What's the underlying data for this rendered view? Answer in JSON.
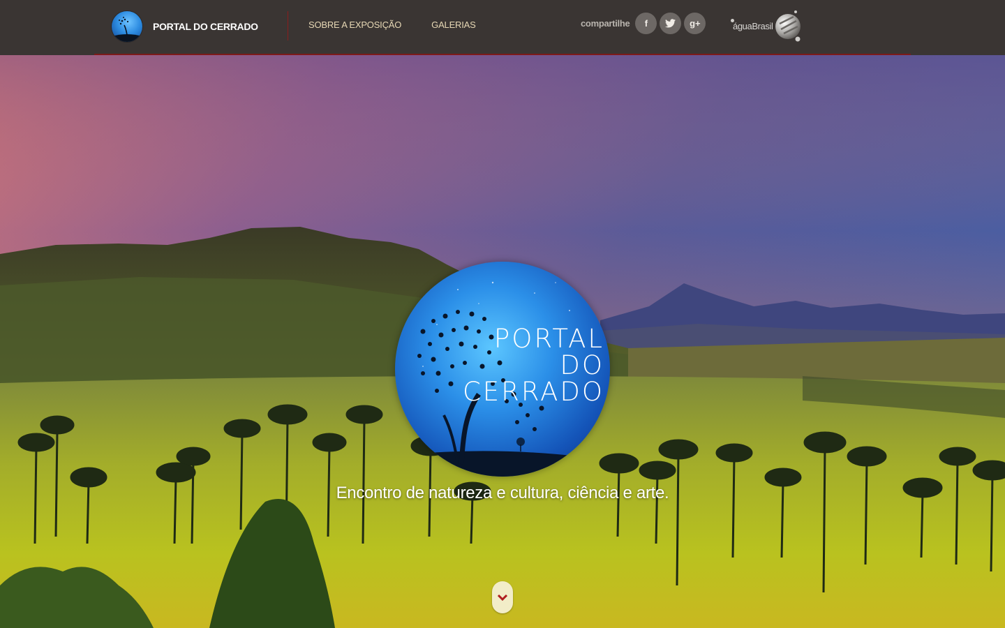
{
  "header": {
    "brand_title": "PORTAL DO CERRADO",
    "nav": [
      {
        "label": "SOBRE A EXPOSIÇÃO"
      },
      {
        "label": "GALERIAS"
      }
    ],
    "share": {
      "label": "compartilhe",
      "buttons": [
        {
          "icon": "facebook-icon",
          "glyph": "f"
        },
        {
          "icon": "twitter-icon",
          "glyph": "t"
        },
        {
          "icon": "google-plus-icon",
          "glyph": "g+"
        }
      ]
    },
    "partner_name": "águaBrasil"
  },
  "hero": {
    "emblem_lines": [
      "PORTAL",
      "DO",
      "CERRADO"
    ],
    "tagline": "Encontro de natureza e cultura, ciência e arte.",
    "scroll_icon": "chevron-down-icon"
  },
  "colors": {
    "topbar": "#3a3533",
    "accent_rule": "#7d1a1a",
    "nav_text": "#e7d8b5",
    "scroll_button": "#f2edc8",
    "scroll_chevron": "#b01f1f"
  }
}
